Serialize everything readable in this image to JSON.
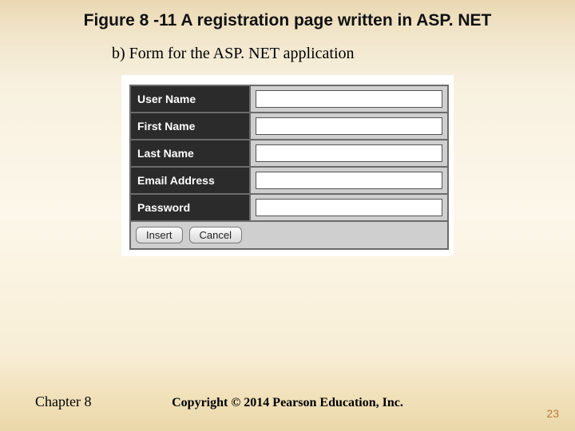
{
  "title": "Figure 8 -11 A registration page written in ASP. NET",
  "subtitle": "b) Form for the ASP. NET application",
  "form": {
    "fields": [
      {
        "label": "User Name",
        "value": ""
      },
      {
        "label": "First Name",
        "value": ""
      },
      {
        "label": "Last Name",
        "value": ""
      },
      {
        "label": "Email Address",
        "value": ""
      },
      {
        "label": "Password",
        "value": ""
      }
    ],
    "buttons": {
      "insert": "Insert",
      "cancel": "Cancel"
    }
  },
  "footer": {
    "chapter": "Chapter 8",
    "copyright": "Copyright © 2014 Pearson Education, Inc.",
    "page_number": "23"
  }
}
